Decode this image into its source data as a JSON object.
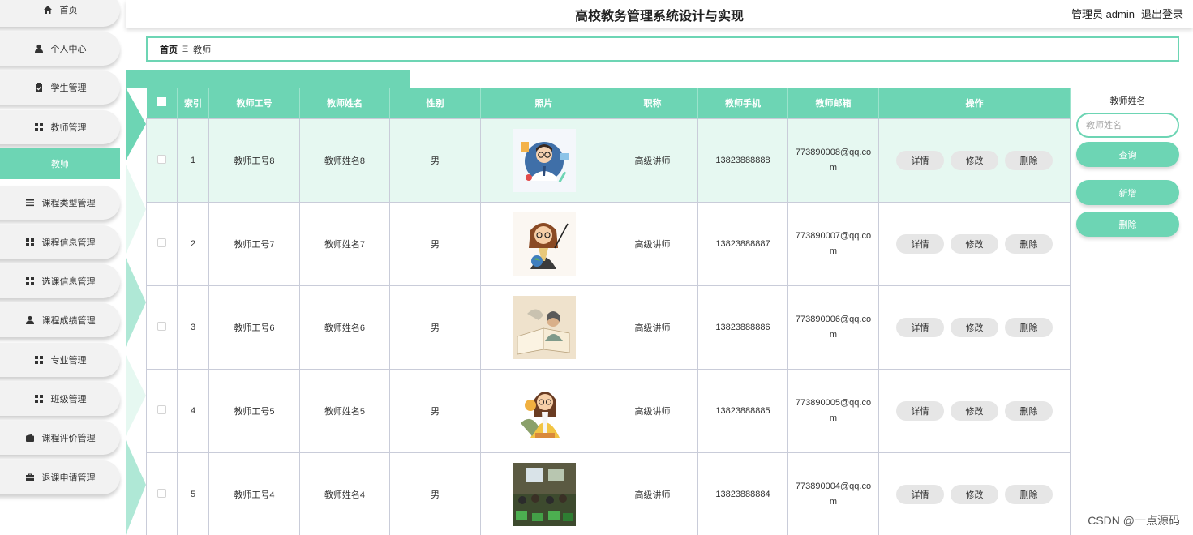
{
  "header": {
    "title": "高校教务管理系统设计与实现",
    "user": "管理员 admin",
    "logout": "退出登录"
  },
  "sidebar": {
    "items": [
      {
        "label": "首页",
        "icon": "home-icon"
      },
      {
        "label": "个人中心",
        "icon": "user-icon"
      },
      {
        "label": "学生管理",
        "icon": "clipboard-icon"
      },
      {
        "label": "教师管理",
        "icon": "grid-icon"
      },
      {
        "label": "教师",
        "icon": "",
        "active": true
      },
      {
        "label": "课程类型管理",
        "icon": "list-icon"
      },
      {
        "label": "课程信息管理",
        "icon": "grid-icon"
      },
      {
        "label": "选课信息管理",
        "icon": "grid-icon"
      },
      {
        "label": "课程成绩管理",
        "icon": "user-icon"
      },
      {
        "label": "专业管理",
        "icon": "grid-icon"
      },
      {
        "label": "班级管理",
        "icon": "grid-icon"
      },
      {
        "label": "课程评价管理",
        "icon": "wallet-icon"
      },
      {
        "label": "退课申请管理",
        "icon": "briefcase-icon"
      }
    ]
  },
  "breadcrumb": {
    "home": "首页",
    "separator": "Ξ",
    "current": "教师"
  },
  "table": {
    "headers": [
      "索引",
      "教师工号",
      "教师姓名",
      "性别",
      "照片",
      "职称",
      "教师手机",
      "教师邮箱",
      "操作"
    ],
    "rows": [
      {
        "index": "1",
        "id": "教师工号8",
        "name": "教师姓名8",
        "gender": "男",
        "title": "高级讲师",
        "phone": "13823888888",
        "email": "773890008@qq.com"
      },
      {
        "index": "2",
        "id": "教师工号7",
        "name": "教师姓名7",
        "gender": "男",
        "title": "高级讲师",
        "phone": "13823888887",
        "email": "773890007@qq.com"
      },
      {
        "index": "3",
        "id": "教师工号6",
        "name": "教师姓名6",
        "gender": "男",
        "title": "高级讲师",
        "phone": "13823888886",
        "email": "773890006@qq.com"
      },
      {
        "index": "4",
        "id": "教师工号5",
        "name": "教师姓名5",
        "gender": "男",
        "title": "高级讲师",
        "phone": "13823888885",
        "email": "773890005@qq.com"
      },
      {
        "index": "5",
        "id": "教师工号4",
        "name": "教师姓名4",
        "gender": "男",
        "title": "高级讲师",
        "phone": "13823888884",
        "email": "773890004@qq.com"
      }
    ],
    "actions": {
      "detail": "详情",
      "edit": "修改",
      "delete": "删除"
    }
  },
  "search": {
    "label": "教师姓名",
    "placeholder": "教师姓名",
    "query_button": "查询",
    "add_button": "新增",
    "delete_button": "删除"
  },
  "colors": {
    "accent": "#6dd5b4",
    "highlight_row": "#e6f8f1"
  },
  "watermark": "CSDN @一点源码"
}
